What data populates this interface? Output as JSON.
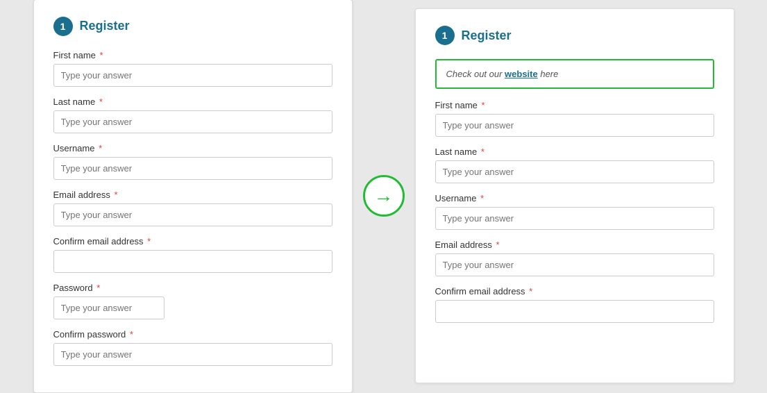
{
  "left_panel": {
    "step": "1",
    "title": "Register",
    "fields": [
      {
        "label": "First name",
        "required": true,
        "placeholder": "Type your answer",
        "type": "text",
        "short": false
      },
      {
        "label": "Last name",
        "required": true,
        "placeholder": "Type your answer",
        "type": "text",
        "short": false
      },
      {
        "label": "Username",
        "required": true,
        "placeholder": "Type your answer",
        "type": "text",
        "short": false
      },
      {
        "label": "Email address",
        "required": true,
        "placeholder": "Type your answer",
        "type": "text",
        "short": false
      },
      {
        "label": "Confirm email address",
        "required": true,
        "placeholder": "",
        "type": "text",
        "short": false
      },
      {
        "label": "Password",
        "required": true,
        "placeholder": "Type your answer",
        "type": "password",
        "short": true
      },
      {
        "label": "Confirm password",
        "required": true,
        "placeholder": "Type your answer",
        "type": "password",
        "short": false
      }
    ]
  },
  "right_panel": {
    "step": "1",
    "title": "Register",
    "banner": {
      "prefix": "Check out our ",
      "link_text": "website",
      "suffix": " here"
    },
    "fields": [
      {
        "label": "First name",
        "required": true,
        "placeholder": "Type your answer",
        "type": "text"
      },
      {
        "label": "Last name",
        "required": true,
        "placeholder": "Type your answer",
        "type": "text"
      },
      {
        "label": "Username",
        "required": true,
        "placeholder": "Type your answer",
        "type": "text"
      },
      {
        "label": "Email address",
        "required": true,
        "placeholder": "Type your answer",
        "type": "text"
      },
      {
        "label": "Confirm email address",
        "required": true,
        "placeholder": "",
        "type": "text"
      }
    ]
  },
  "arrow": {
    "icon": "→"
  }
}
